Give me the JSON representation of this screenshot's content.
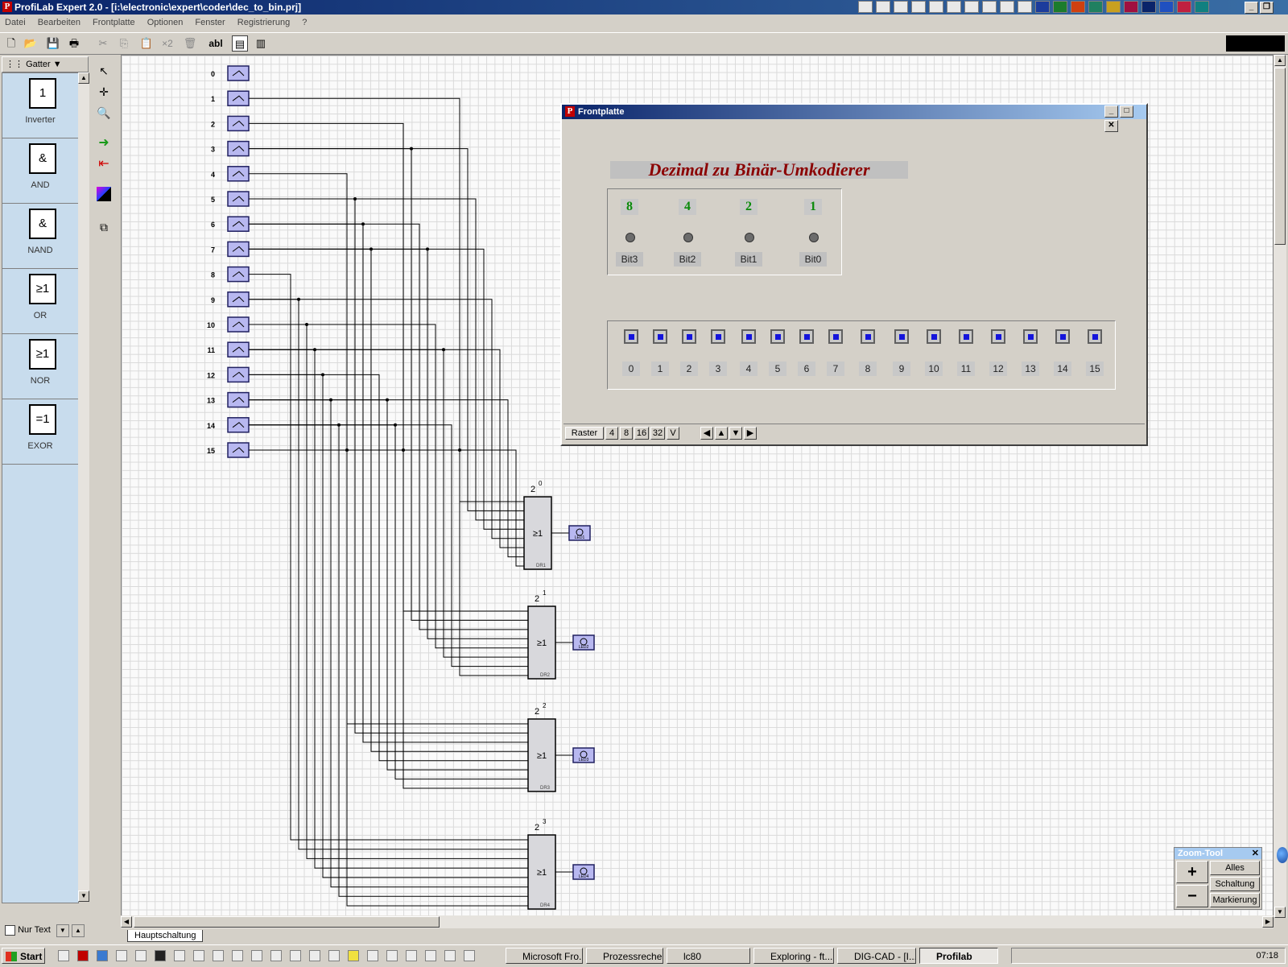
{
  "window": {
    "title": "ProfiLab Expert 2.0 - [i:\\electronic\\expert\\coder\\dec_to_bin.prj]"
  },
  "menu": [
    "Datei",
    "Bearbeiten",
    "Frontplatte",
    "Optionen",
    "Fenster",
    "Registrierung",
    "?"
  ],
  "toolbar": {
    "text_tool": "abl",
    "times_two": "×2"
  },
  "palette": {
    "category": "Gatter",
    "items": [
      {
        "symbol": "1",
        "sub": "INV01",
        "label": "Inverter"
      },
      {
        "symbol": "&",
        "sub": "AND01",
        "label": "AND"
      },
      {
        "symbol": "&",
        "sub": "NAND01",
        "label": "NAND"
      },
      {
        "symbol": "≥1",
        "sub": "OR01",
        "label": "OR"
      },
      {
        "symbol": "≥1",
        "sub": "NOR01",
        "label": "NOR"
      },
      {
        "symbol": "=1",
        "sub": "EXOR01",
        "label": "EXOR"
      }
    ],
    "nur_text": "Nur Text"
  },
  "circuit": {
    "inputs": [
      "0",
      "1",
      "2",
      "3",
      "4",
      "5",
      "6",
      "7",
      "8",
      "9",
      "10",
      "11",
      "12",
      "13",
      "14",
      "15"
    ],
    "gates": [
      {
        "exp": "0",
        "symbol": "≥1",
        "id": "DR1",
        "led": "LED1"
      },
      {
        "exp": "1",
        "symbol": "≥1",
        "id": "DR2",
        "led": "LED2"
      },
      {
        "exp": "2",
        "symbol": "≥1",
        "id": "DR3",
        "led": "LED3"
      },
      {
        "exp": "3",
        "symbol": "≥1",
        "id": "DR4",
        "led": "LED4"
      }
    ],
    "base": "2"
  },
  "frontplatte": {
    "title": "Frontplatte",
    "banner": "Dezimal zu Binär-Umkodierer",
    "bits": [
      {
        "value": "8",
        "label": "Bit3"
      },
      {
        "value": "4",
        "label": "Bit2"
      },
      {
        "value": "2",
        "label": "Bit1"
      },
      {
        "value": "1",
        "label": "Bit0"
      }
    ],
    "switches": [
      "0",
      "1",
      "2",
      "3",
      "4",
      "5",
      "6",
      "7",
      "8",
      "9",
      "10",
      "11",
      "12",
      "13",
      "14",
      "15"
    ],
    "raster": {
      "label": "Raster",
      "options": [
        "4",
        "8",
        "16",
        "32",
        "V"
      ]
    }
  },
  "zoom_tool": {
    "title": "Zoom-Tool",
    "plus": "+",
    "minus": "−",
    "buttons": [
      "Alles",
      "Schaltung",
      "Markierung"
    ]
  },
  "tabs": {
    "main": "Hauptschaltung"
  },
  "taskbar": {
    "start": "Start",
    "tasks": [
      "Microsoft Fro...",
      "Prozessreche...",
      "lc80",
      "Exploring - ft...",
      "DIG-CAD - [I...",
      "Profilab"
    ],
    "clock": "07:18"
  }
}
